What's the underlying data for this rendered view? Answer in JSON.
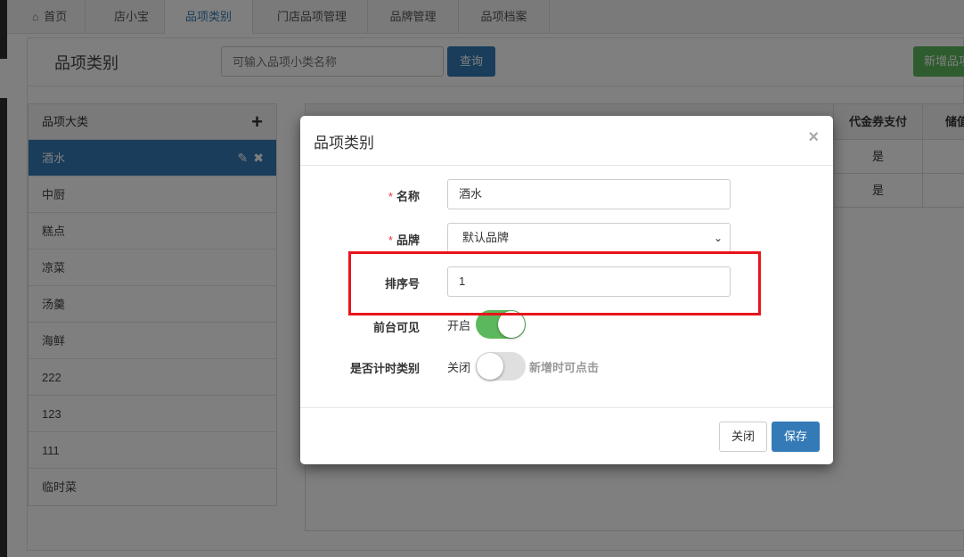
{
  "tabs": [
    {
      "label": "首页",
      "icon": "home-icon"
    },
    {
      "label": "店小宝"
    },
    {
      "label": "品项类别",
      "active": true
    },
    {
      "label": "门店品项管理"
    },
    {
      "label": "品牌管理"
    },
    {
      "label": "品项档案"
    }
  ],
  "page": {
    "title": "品项类别",
    "search_placeholder": "可输入品项小类名称",
    "search_button": "查询",
    "add_button": "新增品项"
  },
  "categories": {
    "header": "品项大类",
    "add_icon": "plus-icon",
    "items": [
      "酒水",
      "中厨",
      "糕点",
      "凉菜",
      "汤羹",
      "海鲜",
      "222",
      "123",
      "111",
      "临时菜"
    ],
    "active_index": 0
  },
  "table": {
    "headers": [
      "代金券支付",
      "储值"
    ],
    "rows": [
      [
        "是",
        ""
      ],
      [
        "是",
        ""
      ]
    ]
  },
  "modal": {
    "title": "品项类别",
    "close_symbol": "×",
    "fields": {
      "name": {
        "label": "名称",
        "required": "*",
        "value": "酒水"
      },
      "brand": {
        "label": "品牌",
        "required": "*",
        "value": "默认品牌"
      },
      "sort": {
        "label": "排序号",
        "value": "1"
      },
      "visible": {
        "label": "前台可见",
        "state_text": "开启",
        "on": true
      },
      "timed": {
        "label": "是否计时类别",
        "state_text": "关闭",
        "on": false,
        "hint": "新增时可点击"
      }
    },
    "close_button": "关闭",
    "save_button": "保存"
  },
  "colors": {
    "primary": "#337ab7",
    "success": "#5cb85c",
    "highlight": "#e8141c"
  }
}
